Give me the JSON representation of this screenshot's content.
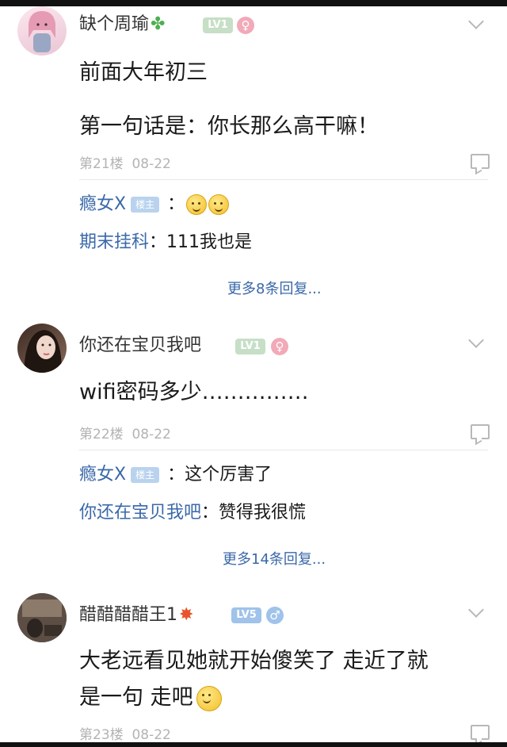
{
  "posts": [
    {
      "username": "缺个周瑜",
      "user_icon": "four-leaf-clover-icon",
      "level": "LV1",
      "level_color": "#c6dfc6",
      "gender_icon": "female-icon",
      "gender_color": "#f2a9b8",
      "content": [
        "前面大年初三",
        "第一句话是：你长那么高干嘛！"
      ],
      "floor": "第21楼",
      "date": "08-22",
      "replies": [
        {
          "name": "瘾女X",
          "host_badge": "楼主",
          "text": "：",
          "emojis": [
            "sweat-smile-emoji-icon",
            "sweat-smile-emoji-icon"
          ]
        },
        {
          "name": "期末挂科",
          "text": "：111我也是"
        }
      ],
      "more": "更多8条回复..."
    },
    {
      "username": "你还在宝贝我吧",
      "level": "LV1",
      "level_color": "#c6dfc6",
      "gender_icon": "female-icon",
      "gender_color": "#f2a9b8",
      "content": [
        "wifi密码多少……………"
      ],
      "floor": "第22楼",
      "date": "08-22",
      "replies": [
        {
          "name": "瘾女X",
          "host_badge": "楼主",
          "text": "：这个厉害了"
        },
        {
          "name": "你还在宝贝我吧",
          "text": "：赞得我很慌"
        }
      ],
      "more": "更多14条回复..."
    },
    {
      "username": "醋醋醋醋王1",
      "user_icon": "explosion-icon",
      "level": "LV5",
      "level_color": "#9fc3ea",
      "gender_icon": "male-icon",
      "gender_color": "#9fc3ea",
      "content": [
        "大老远看见她就开始傻笑了 走近了就",
        "是一句 走吧"
      ],
      "content_emoji": "grin-emoji-icon",
      "floor": "第23楼",
      "date": "08-22"
    }
  ]
}
